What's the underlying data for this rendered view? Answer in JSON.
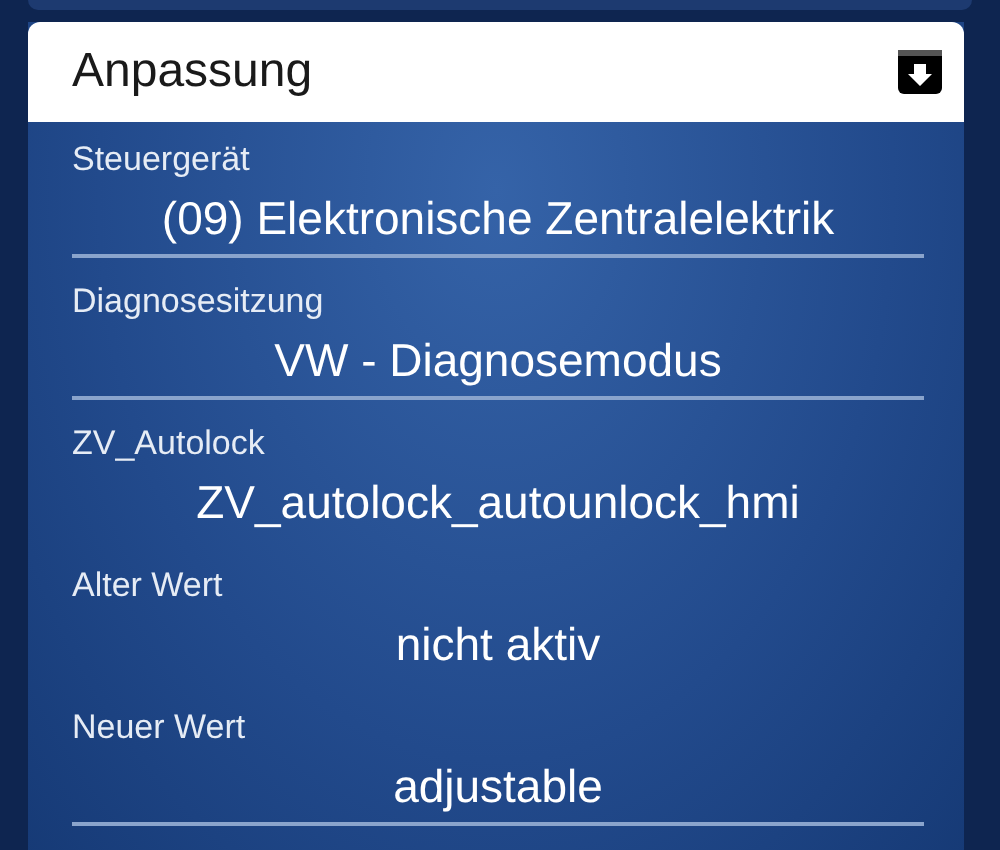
{
  "panel": {
    "title": "Anpassung"
  },
  "fields": [
    {
      "label": "Steuergerät",
      "value": "(09) Elektronische Zentralelektrik",
      "underlined": true
    },
    {
      "label": "Diagnosesitzung",
      "value": "VW - Diagnosemodus",
      "underlined": true
    },
    {
      "label": "ZV_Autolock",
      "value": "ZV_autolock_autounlock_hmi",
      "underlined": false
    },
    {
      "label": "Alter Wert",
      "value": "nicht aktiv",
      "underlined": false
    },
    {
      "label": "Neuer Wert",
      "value": "adjustable",
      "underlined": true
    }
  ]
}
